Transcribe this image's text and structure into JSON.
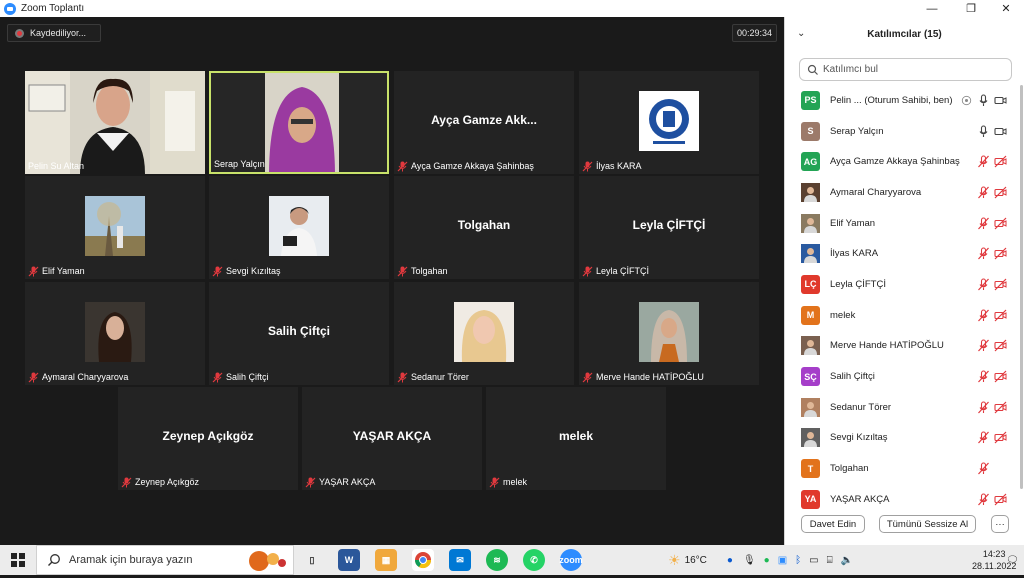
{
  "window": {
    "title": "Zoom Toplantı",
    "minimize": "—",
    "maximize": "❐",
    "close": "✕"
  },
  "meeting": {
    "recording_label": "Kaydediliyor...",
    "timer": "00:29:34",
    "tiles": [
      {
        "name": "Pelin Su Altan",
        "center": "",
        "muted": false,
        "kind": "video-office"
      },
      {
        "name": "Serap Yalçın",
        "center": "",
        "muted": false,
        "kind": "video-hijab",
        "active": true
      },
      {
        "name": "Ayça Gamze Akkaya Şahinbaş",
        "center": "Ayça Gamze Akk...",
        "muted": true,
        "kind": "name"
      },
      {
        "name": "İlyas KARA",
        "center": "",
        "muted": true,
        "kind": "logo"
      },
      {
        "name": "Elif Yaman",
        "center": "",
        "muted": true,
        "kind": "photo-tree"
      },
      {
        "name": "Sevgi Kızıltaş",
        "center": "",
        "muted": true,
        "kind": "photo-person"
      },
      {
        "name": "Tolgahan",
        "center": "Tolgahan",
        "muted": true,
        "kind": "name"
      },
      {
        "name": "Leyla ÇİFTÇİ",
        "center": "Leyla ÇİFTÇİ",
        "muted": true,
        "kind": "name"
      },
      {
        "name": "Aymaral Charyyarova",
        "center": "",
        "muted": true,
        "kind": "photo-hair"
      },
      {
        "name": "Salih  Çiftçi",
        "center": "Salih  Çiftçi",
        "muted": true,
        "kind": "name"
      },
      {
        "name": "Sedanur Törer",
        "center": "",
        "muted": true,
        "kind": "photo-blonde"
      },
      {
        "name": "Merve Hande HATİPOĞLU",
        "center": "",
        "muted": true,
        "kind": "photo-hijab"
      },
      {
        "name": "Zeynep Açıkgöz",
        "center": "Zeynep Açıkgöz",
        "muted": true,
        "kind": "name"
      },
      {
        "name": "YAŞAR AKÇA",
        "center": "YAŞAR AKÇA",
        "muted": true,
        "kind": "name"
      },
      {
        "name": "melek",
        "center": "melek",
        "muted": true,
        "kind": "name"
      }
    ]
  },
  "participants": {
    "title": "Katılımcılar (15)",
    "search_placeholder": "Katılımcı bul",
    "list": [
      {
        "initials": "PS",
        "color": "#23a455",
        "name": "Pelin ...  (Oturum Sahibi, ben)",
        "mic": "on",
        "video": "on",
        "extra": true
      },
      {
        "initials": "S",
        "color": "#9c7a6a",
        "name": "Serap Yalçın",
        "mic": "on",
        "video": "on"
      },
      {
        "initials": "AG",
        "color": "#23a455",
        "name": "Ayça Gamze Akkaya Şahinbaş",
        "mic": "off",
        "video": "off"
      },
      {
        "initials": "",
        "color": "#5a4030",
        "name": "Aymaral Charyyarova",
        "mic": "off",
        "video": "off",
        "photo": true
      },
      {
        "initials": "",
        "color": "#8a7a60",
        "name": "Elif Yaman",
        "mic": "off",
        "video": "off",
        "photo": true
      },
      {
        "initials": "",
        "color": "#2a5aa0",
        "name": "İlyas KARA",
        "mic": "off",
        "video": "off",
        "photo": true
      },
      {
        "initials": "LÇ",
        "color": "#e0392c",
        "name": "Leyla ÇİFTÇİ",
        "mic": "off",
        "video": "off"
      },
      {
        "initials": "M",
        "color": "#e2731c",
        "name": "melek",
        "mic": "off",
        "video": "off"
      },
      {
        "initials": "",
        "color": "#7a6050",
        "name": "Merve Hande HATİPOĞLU",
        "mic": "off",
        "video": "off",
        "photo": true
      },
      {
        "initials": "SÇ",
        "color": "#a53ec9",
        "name": "Salih  Çiftçi",
        "mic": "off",
        "video": "off"
      },
      {
        "initials": "",
        "color": "#b08060",
        "name": "Sedanur Törer",
        "mic": "off",
        "video": "off",
        "photo": true
      },
      {
        "initials": "",
        "color": "#606060",
        "name": "Sevgi Kızıltaş",
        "mic": "off",
        "video": "off",
        "photo": true
      },
      {
        "initials": "T",
        "color": "#e2731c",
        "name": "Tolgahan",
        "mic": "off",
        "video": "none"
      },
      {
        "initials": "YA",
        "color": "#e0392c",
        "name": "YAŞAR AKÇA",
        "mic": "off",
        "video": "off"
      }
    ],
    "invite_label": "Davet Edin",
    "mute_all_label": "Tümünü Sessize Al",
    "more_label": "···"
  },
  "taskbar": {
    "search_placeholder": "Aramak için buraya yazın",
    "weather": "16°C",
    "time": "14:23",
    "date": "28.11.2022"
  }
}
